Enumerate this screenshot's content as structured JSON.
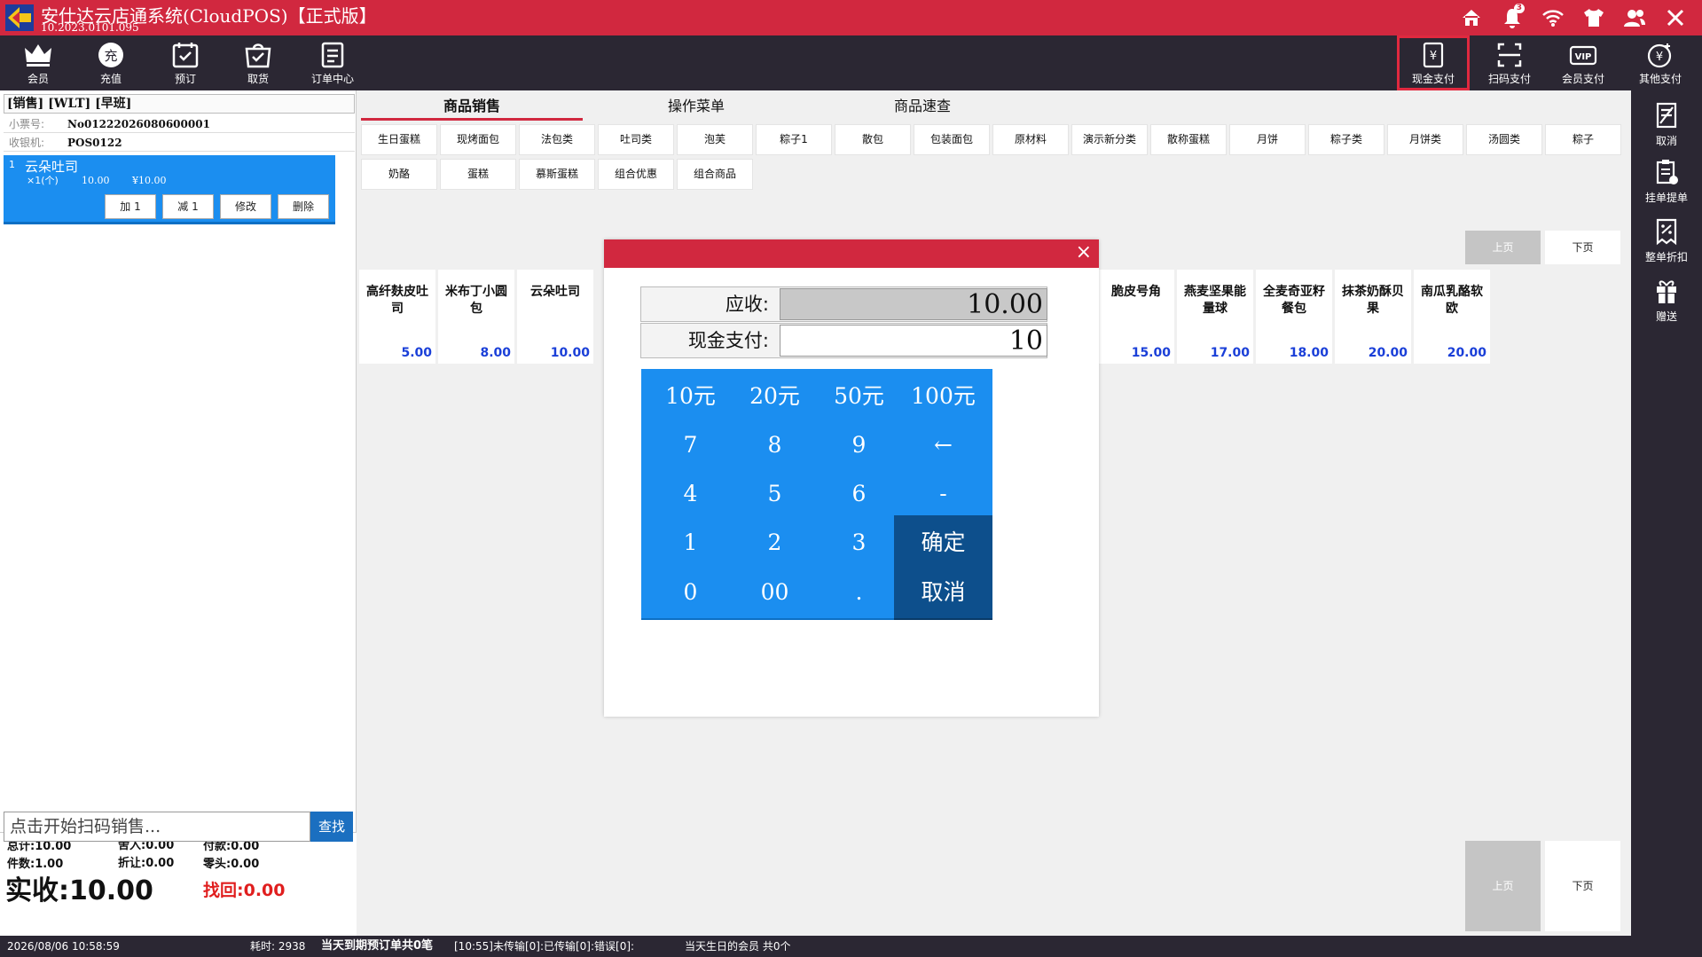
{
  "title_bar": {
    "title": "安仕达云店通系统(CloudPOS)【正式版】",
    "version": "10.2023.0101.095",
    "notification_count": "3"
  },
  "toolbar": {
    "left": [
      "会员",
      "充值",
      "预订",
      "取货",
      "订单中心"
    ],
    "recharge_glyph": "充",
    "right": [
      "现金支付",
      "扫码支付",
      "会员支付",
      "其他支付"
    ],
    "vip_glyph": "VIP",
    "yen_glyph": "¥"
  },
  "right_sidebar": [
    "取消",
    "挂单提单",
    "整单折扣",
    "赠送"
  ],
  "left_panel": {
    "mode": "[销售] [WLT] [早班]",
    "ticket_label": "小票号:",
    "ticket_no": "No01222026080600001",
    "cashier_label": "收银机:",
    "cashier": "POS0122",
    "cart": {
      "index": "1",
      "name": "云朵吐司",
      "qty": "×1(个)",
      "price": "10.00",
      "total": "¥10.00",
      "buttons": [
        "加 1",
        "减 1",
        "修改",
        "删除"
      ]
    },
    "summary": {
      "total": "总计:10.00",
      "round_in": "舍入:0.00",
      "paid": "付款:0.00",
      "count": "件数:1.00",
      "discount": "折让:0.00",
      "change_small": "零头:0.00",
      "actual": "实收:10.00",
      "change": "找回:0.00"
    },
    "scan_placeholder": "点击开始扫码销售...",
    "find_button": "查找"
  },
  "main": {
    "tabs": [
      "商品销售",
      "操作菜单",
      "商品速查"
    ],
    "categories_row1": [
      "生日蛋糕",
      "现烤面包",
      "法包类",
      "吐司类",
      "泡芙",
      "粽子1",
      "散包",
      "包装面包",
      "原材料",
      "演示新分类",
      "散称蛋糕",
      "月饼",
      "粽子类",
      "月饼类",
      "汤圆类",
      "粽子"
    ],
    "categories_row2": [
      "奶酪",
      "蛋糕",
      "慕斯蛋糕",
      "组合优惠",
      "组合商品"
    ],
    "pager": {
      "prev": "上页",
      "next": "下页"
    },
    "products_left": [
      {
        "name": "高纤麸皮吐司",
        "price": "5.00"
      },
      {
        "name": "米布丁小圆包",
        "price": "8.00"
      },
      {
        "name": "云朵吐司",
        "price": "10.00"
      }
    ],
    "products_right": [
      {
        "name": "脆皮号角",
        "price": "15.00"
      },
      {
        "name": "燕麦坚果能量球",
        "price": "17.00"
      },
      {
        "name": "全麦奇亚籽餐包",
        "price": "18.00"
      },
      {
        "name": "抹茶奶酥贝果",
        "price": "20.00"
      },
      {
        "name": "南瓜乳酪软欧",
        "price": "20.00"
      }
    ]
  },
  "modal": {
    "due_label": "应收:",
    "due_value": "10.00",
    "cash_label": "现金支付:",
    "cash_value": "10",
    "close": "×",
    "keys": [
      [
        "10元",
        "20元",
        "50元",
        "100元"
      ],
      [
        "7",
        "8",
        "9",
        "←"
      ],
      [
        "4",
        "5",
        "6",
        "-"
      ],
      [
        "1",
        "2",
        "3",
        "确定"
      ],
      [
        "0",
        "00",
        ".",
        "取消"
      ]
    ]
  },
  "status_bar": {
    "datetime": "2026/08/06 10:58:59",
    "elapsed": "耗时: 2938",
    "reservations": "当天到期预订单共0笔",
    "upload": "[10:55]未传输[0]:已传输[0]:错误[0]:",
    "birthday": "当天生日的会员 共0个"
  },
  "colors": {
    "brand_red": "#d1283f",
    "key_blue": "#1b8ef0",
    "key_dark": "#0d4f8c",
    "bar_dark": "#2b2733",
    "price_blue": "#1a3fd8"
  }
}
